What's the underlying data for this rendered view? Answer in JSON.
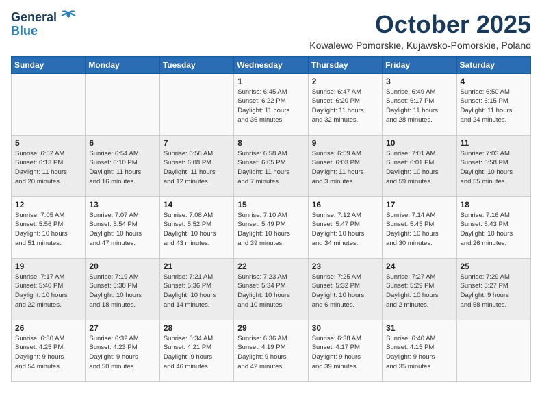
{
  "logo": {
    "general": "General",
    "blue": "Blue"
  },
  "header": {
    "title": "October 2025",
    "subtitle": "Kowalewo Pomorskie, Kujawsko-Pomorskie, Poland"
  },
  "days_of_week": [
    "Sunday",
    "Monday",
    "Tuesday",
    "Wednesday",
    "Thursday",
    "Friday",
    "Saturday"
  ],
  "weeks": [
    [
      {
        "day": "",
        "info": ""
      },
      {
        "day": "",
        "info": ""
      },
      {
        "day": "",
        "info": ""
      },
      {
        "day": "1",
        "info": "Sunrise: 6:45 AM\nSunset: 6:22 PM\nDaylight: 11 hours\nand 36 minutes."
      },
      {
        "day": "2",
        "info": "Sunrise: 6:47 AM\nSunset: 6:20 PM\nDaylight: 11 hours\nand 32 minutes."
      },
      {
        "day": "3",
        "info": "Sunrise: 6:49 AM\nSunset: 6:17 PM\nDaylight: 11 hours\nand 28 minutes."
      },
      {
        "day": "4",
        "info": "Sunrise: 6:50 AM\nSunset: 6:15 PM\nDaylight: 11 hours\nand 24 minutes."
      }
    ],
    [
      {
        "day": "5",
        "info": "Sunrise: 6:52 AM\nSunset: 6:13 PM\nDaylight: 11 hours\nand 20 minutes."
      },
      {
        "day": "6",
        "info": "Sunrise: 6:54 AM\nSunset: 6:10 PM\nDaylight: 11 hours\nand 16 minutes."
      },
      {
        "day": "7",
        "info": "Sunrise: 6:56 AM\nSunset: 6:08 PM\nDaylight: 11 hours\nand 12 minutes."
      },
      {
        "day": "8",
        "info": "Sunrise: 6:58 AM\nSunset: 6:05 PM\nDaylight: 11 hours\nand 7 minutes."
      },
      {
        "day": "9",
        "info": "Sunrise: 6:59 AM\nSunset: 6:03 PM\nDaylight: 11 hours\nand 3 minutes."
      },
      {
        "day": "10",
        "info": "Sunrise: 7:01 AM\nSunset: 6:01 PM\nDaylight: 10 hours\nand 59 minutes."
      },
      {
        "day": "11",
        "info": "Sunrise: 7:03 AM\nSunset: 5:58 PM\nDaylight: 10 hours\nand 55 minutes."
      }
    ],
    [
      {
        "day": "12",
        "info": "Sunrise: 7:05 AM\nSunset: 5:56 PM\nDaylight: 10 hours\nand 51 minutes."
      },
      {
        "day": "13",
        "info": "Sunrise: 7:07 AM\nSunset: 5:54 PM\nDaylight: 10 hours\nand 47 minutes."
      },
      {
        "day": "14",
        "info": "Sunrise: 7:08 AM\nSunset: 5:52 PM\nDaylight: 10 hours\nand 43 minutes."
      },
      {
        "day": "15",
        "info": "Sunrise: 7:10 AM\nSunset: 5:49 PM\nDaylight: 10 hours\nand 39 minutes."
      },
      {
        "day": "16",
        "info": "Sunrise: 7:12 AM\nSunset: 5:47 PM\nDaylight: 10 hours\nand 34 minutes."
      },
      {
        "day": "17",
        "info": "Sunrise: 7:14 AM\nSunset: 5:45 PM\nDaylight: 10 hours\nand 30 minutes."
      },
      {
        "day": "18",
        "info": "Sunrise: 7:16 AM\nSunset: 5:43 PM\nDaylight: 10 hours\nand 26 minutes."
      }
    ],
    [
      {
        "day": "19",
        "info": "Sunrise: 7:17 AM\nSunset: 5:40 PM\nDaylight: 10 hours\nand 22 minutes."
      },
      {
        "day": "20",
        "info": "Sunrise: 7:19 AM\nSunset: 5:38 PM\nDaylight: 10 hours\nand 18 minutes."
      },
      {
        "day": "21",
        "info": "Sunrise: 7:21 AM\nSunset: 5:36 PM\nDaylight: 10 hours\nand 14 minutes."
      },
      {
        "day": "22",
        "info": "Sunrise: 7:23 AM\nSunset: 5:34 PM\nDaylight: 10 hours\nand 10 minutes."
      },
      {
        "day": "23",
        "info": "Sunrise: 7:25 AM\nSunset: 5:32 PM\nDaylight: 10 hours\nand 6 minutes."
      },
      {
        "day": "24",
        "info": "Sunrise: 7:27 AM\nSunset: 5:29 PM\nDaylight: 10 hours\nand 2 minutes."
      },
      {
        "day": "25",
        "info": "Sunrise: 7:29 AM\nSunset: 5:27 PM\nDaylight: 9 hours\nand 58 minutes."
      }
    ],
    [
      {
        "day": "26",
        "info": "Sunrise: 6:30 AM\nSunset: 4:25 PM\nDaylight: 9 hours\nand 54 minutes."
      },
      {
        "day": "27",
        "info": "Sunrise: 6:32 AM\nSunset: 4:23 PM\nDaylight: 9 hours\nand 50 minutes."
      },
      {
        "day": "28",
        "info": "Sunrise: 6:34 AM\nSunset: 4:21 PM\nDaylight: 9 hours\nand 46 minutes."
      },
      {
        "day": "29",
        "info": "Sunrise: 6:36 AM\nSunset: 4:19 PM\nDaylight: 9 hours\nand 42 minutes."
      },
      {
        "day": "30",
        "info": "Sunrise: 6:38 AM\nSunset: 4:17 PM\nDaylight: 9 hours\nand 39 minutes."
      },
      {
        "day": "31",
        "info": "Sunrise: 6:40 AM\nSunset: 4:15 PM\nDaylight: 9 hours\nand 35 minutes."
      },
      {
        "day": "",
        "info": ""
      }
    ]
  ]
}
